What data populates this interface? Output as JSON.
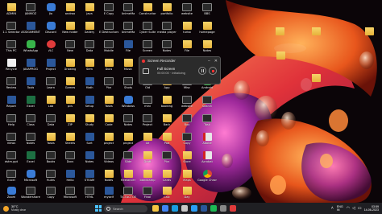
{
  "desktop": {
    "icons": [
      {
        "label": "ADMIN",
        "type": "folder"
      },
      {
        "label": "JANMOZ",
        "type": "app"
      },
      {
        "label": "Jio",
        "type": "blue"
      },
      {
        "label": "androo",
        "type": "folder"
      },
      {
        "label": "java",
        "type": "folder"
      },
      {
        "label": "E Copy",
        "type": "app"
      },
      {
        "label": "AnimeMa",
        "type": "app"
      },
      {
        "label": "Constructor",
        "type": "folder"
      },
      {
        "label": "portfolio",
        "type": "folder"
      },
      {
        "label": "website",
        "type": "app"
      },
      {
        "label": "BBS",
        "type": "app"
      },
      {
        "label": "1.1 Selector",
        "type": "app"
      },
      {
        "label": "ASSIGNMENT",
        "type": "word"
      },
      {
        "label": "Discord",
        "type": "blue"
      },
      {
        "label": "New folder",
        "type": "folder"
      },
      {
        "label": "Gallery",
        "type": "folder"
      },
      {
        "label": "E Destructors",
        "type": "app"
      },
      {
        "label": "AnimeMa",
        "type": "app"
      },
      {
        "label": "Cyber Suite",
        "type": "app"
      },
      {
        "label": "media player",
        "type": "app"
      },
      {
        "label": "turbo",
        "type": "folder"
      },
      {
        "label": "homepage",
        "type": "folder"
      },
      {
        "label": "This PC",
        "type": "app"
      },
      {
        "label": "WhatsApp",
        "type": "green"
      },
      {
        "label": "VLC",
        "type": "red"
      },
      {
        "label": "New",
        "type": "app"
      },
      {
        "label": "Data",
        "type": "app"
      },
      {
        "label": "Mobile",
        "type": "app"
      },
      {
        "label": "File",
        "type": "word"
      },
      {
        "label": "Screen",
        "type": "app"
      },
      {
        "label": "Notes",
        "type": "app"
      },
      {
        "label": "File",
        "type": "folder"
      },
      {
        "label": "Notes",
        "type": "folder"
      },
      {
        "label": "Recycle",
        "type": "white"
      },
      {
        "label": "JAVAPROG",
        "type": "word"
      },
      {
        "label": "Project",
        "type": "word"
      },
      {
        "label": "Drawing",
        "type": "folder"
      },
      {
        "label": "Sem",
        "type": "folder"
      },
      {
        "label": "Docs",
        "type": "folder"
      },
      {
        "label": "Music",
        "type": "folder"
      },
      {
        "label": "Links",
        "type": "folder"
      },
      {
        "label": "Work",
        "type": "app"
      },
      {
        "label": "Temp",
        "type": "folder"
      },
      {
        "label": "Files",
        "type": "app"
      },
      {
        "label": "Review",
        "type": "app"
      },
      {
        "label": "Tools",
        "type": "word"
      },
      {
        "label": "Learn",
        "type": "app"
      },
      {
        "label": "Games",
        "type": "folder"
      },
      {
        "label": "Math",
        "type": "word"
      },
      {
        "label": "Pics",
        "type": "app"
      },
      {
        "label": "Shots",
        "type": "app"
      },
      {
        "label": "Old",
        "type": "app"
      },
      {
        "label": "App",
        "type": "folder"
      },
      {
        "label": "Misc",
        "type": "app"
      },
      {
        "label": "Android",
        "type": "green"
      },
      {
        "label": "Report",
        "type": "word"
      },
      {
        "label": "Excel",
        "type": "excel"
      },
      {
        "label": "Lab",
        "type": "folder"
      },
      {
        "label": "pcs",
        "type": "folder"
      },
      {
        "label": "Setup",
        "type": "word"
      },
      {
        "label": "Tasks",
        "type": "folder"
      },
      {
        "label": "Windows",
        "type": "blue"
      },
      {
        "label": "mini",
        "type": "app"
      },
      {
        "label": "booking",
        "type": "folder"
      },
      {
        "label": "website",
        "type": "app"
      },
      {
        "label": "Search",
        "type": "app"
      },
      {
        "label": "Help",
        "type": "app"
      },
      {
        "label": "Class",
        "type": "app"
      },
      {
        "label": "Data",
        "type": "app"
      },
      {
        "label": "ZIP",
        "type": "folder"
      },
      {
        "label": "Study",
        "type": "folder"
      },
      {
        "label": "Code",
        "type": "folder"
      },
      {
        "label": "Notes",
        "type": "app"
      },
      {
        "label": "Project",
        "type": "app"
      },
      {
        "label": "Back",
        "type": "folder"
      },
      {
        "label": "Box",
        "type": "app"
      },
      {
        "label": "Task",
        "type": "app"
      },
      {
        "label": "Views",
        "type": "app"
      },
      {
        "label": "Notes",
        "type": "app"
      },
      {
        "label": "Tasks",
        "type": "folder"
      },
      {
        "label": "Sheets",
        "type": "folder"
      },
      {
        "label": "Sort",
        "type": "word"
      },
      {
        "label": "project",
        "type": "folder"
      },
      {
        "label": "project",
        "type": "folder"
      },
      {
        "label": "Alt",
        "type": "folder"
      },
      {
        "label": "Pad",
        "type": "folder"
      },
      {
        "label": "Copy",
        "type": "app"
      },
      {
        "label": "Adobe",
        "type": "pdf"
      },
      {
        "label": "dstm.ppt",
        "type": "app"
      },
      {
        "label": "Excel",
        "type": "excel"
      },
      {
        "label": "Books",
        "type": "app"
      },
      {
        "label": "Docs",
        "type": "app"
      },
      {
        "label": "Notes",
        "type": "word"
      },
      {
        "label": "Videos",
        "type": "app"
      },
      {
        "label": "Slide",
        "type": "app"
      },
      {
        "label": "Draft",
        "type": "folder"
      },
      {
        "label": "Pics",
        "type": "app"
      },
      {
        "label": "Store",
        "type": "folder"
      },
      {
        "label": "Acrobat",
        "type": "pdf"
      },
      {
        "label": "Excel",
        "type": "app"
      },
      {
        "label": "Microsoft",
        "type": "blue"
      },
      {
        "label": "Rules",
        "type": "app"
      },
      {
        "label": "Hello",
        "type": "word"
      },
      {
        "label": "STEAM",
        "type": "word"
      },
      {
        "label": "Notes",
        "type": "folder"
      },
      {
        "label": "freelancer",
        "type": "folder"
      },
      {
        "label": "bandcamp",
        "type": "folder"
      },
      {
        "label": "Cards",
        "type": "folder"
      },
      {
        "label": "Maps",
        "type": "folder"
      },
      {
        "label": "Google Chrome",
        "type": "chrome"
      },
      {
        "label": "Zoom",
        "type": "blue"
      },
      {
        "label": "Wondershare",
        "type": "app"
      },
      {
        "label": "Copy",
        "type": "app"
      },
      {
        "label": "Microsoft",
        "type": "app"
      },
      {
        "label": "HTML",
        "type": "app"
      },
      {
        "label": "myself",
        "type": "word"
      },
      {
        "label": "TICTACTOE",
        "type": "app"
      },
      {
        "label": "Final",
        "type": "app"
      },
      {
        "label": "Calc",
        "type": "folder"
      },
      {
        "label": "Day",
        "type": "folder"
      }
    ]
  },
  "recorder": {
    "title": "Screen Recorder",
    "mode": "Full Screen",
    "timer": "00:00:00 · Initializing",
    "minimize": "–",
    "close": "✕"
  },
  "taskbar": {
    "weather_temp": "30°C",
    "weather_cond": "Mostly clear",
    "search_placeholder": "Search",
    "apps": [
      {
        "name": "file-explorer",
        "color": "#f5c542"
      },
      {
        "name": "chrome",
        "color": "#4285f4"
      },
      {
        "name": "edge",
        "color": "#1a9de0"
      },
      {
        "name": "store",
        "color": "#c8c8c8"
      },
      {
        "name": "vscode",
        "color": "#2a9ef5"
      },
      {
        "name": "word",
        "color": "#2b579a"
      },
      {
        "name": "spotify",
        "color": "#1db954"
      },
      {
        "name": "settings",
        "color": "#888888"
      },
      {
        "name": "recorder",
        "color": "#e03b3b"
      }
    ],
    "lang_line1": "ENG",
    "lang_line2": "IN",
    "time": "03:59",
    "date": "14-06-2023"
  }
}
